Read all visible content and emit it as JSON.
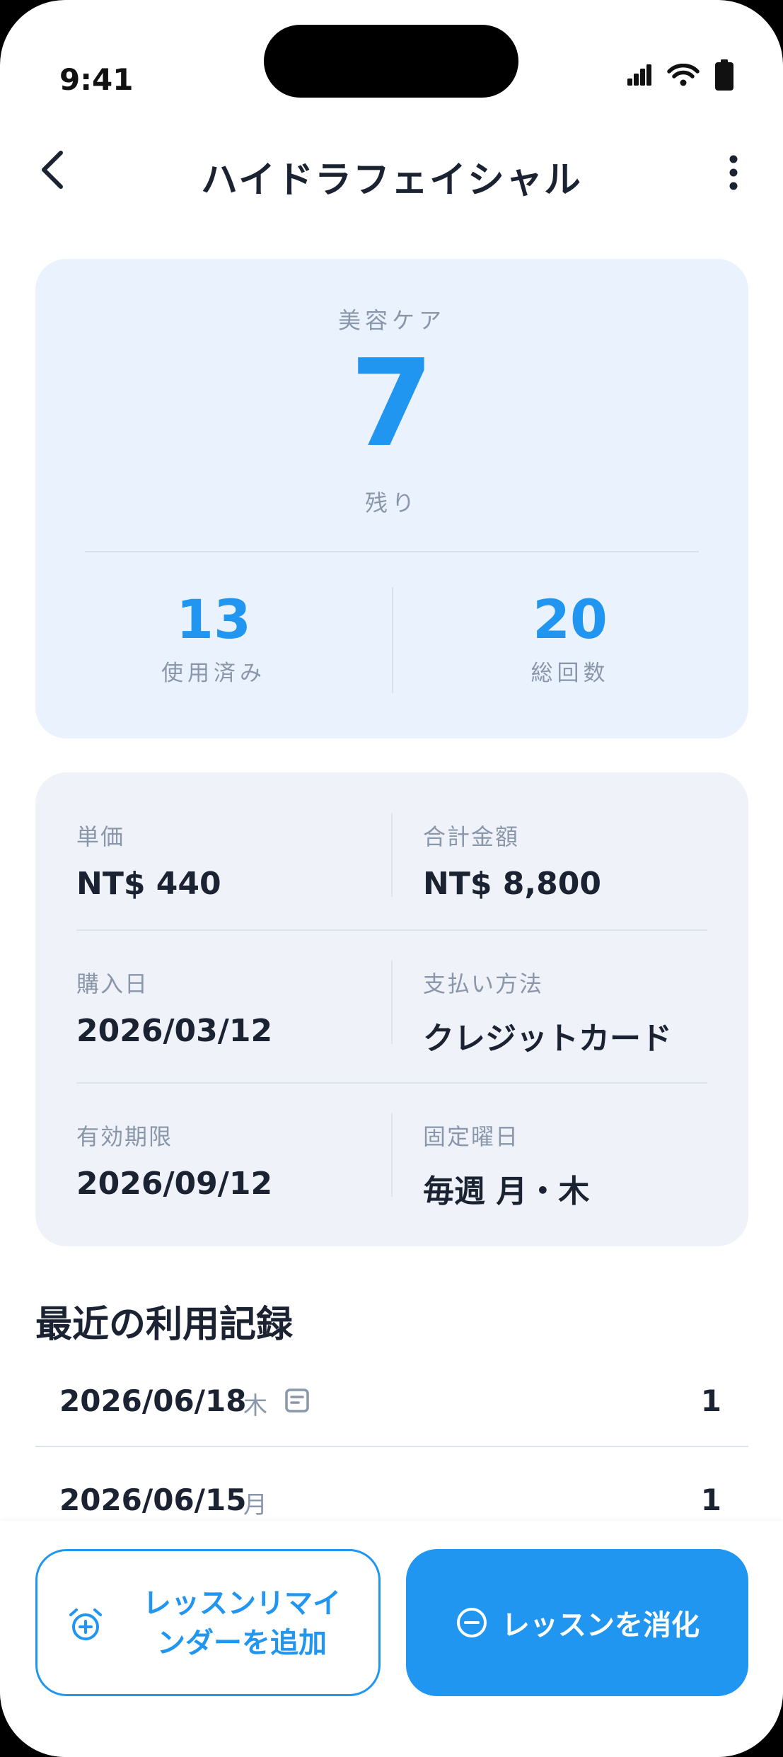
{
  "status_bar": {
    "time": "9:41"
  },
  "header": {
    "title": "ハイドラフェイシャル"
  },
  "summary": {
    "category": "美容ケア",
    "remaining": "7",
    "remaining_label": "残り",
    "used": "13",
    "used_label": "使用済み",
    "total": "20",
    "total_label": "総回数"
  },
  "info": {
    "unit_price_label": "単価",
    "unit_price": "NT$ 440",
    "total_amount_label": "合計金額",
    "total_amount": "NT$ 8,800",
    "purchase_date_label": "購入日",
    "purchase_date": "2026/03/12",
    "payment_method_label": "支払い方法",
    "payment_method": "クレジットカード",
    "expiry_label": "有効期限",
    "expiry": "2026/09/12",
    "fixed_day_label": "固定曜日",
    "fixed_day": "毎週 月・木"
  },
  "records": {
    "title": "最近の利用記録",
    "items": [
      {
        "date": "2026/06/18",
        "weekday": "木",
        "count": "1",
        "has_note": true
      },
      {
        "date": "2026/06/15",
        "weekday": "月",
        "count": "1",
        "has_note": false
      }
    ]
  },
  "actions": {
    "reminder_label_line1": "レッスンリマイ",
    "reminder_label_line2": "ンダーを追加",
    "consume_label": "レッスンを消化"
  },
  "colors": {
    "accent": "#2196f0",
    "summary_bg": "#eaf3fd",
    "info_bg": "#eff3f9",
    "text_primary": "#1b2333",
    "text_secondary": "#8a97aa"
  }
}
